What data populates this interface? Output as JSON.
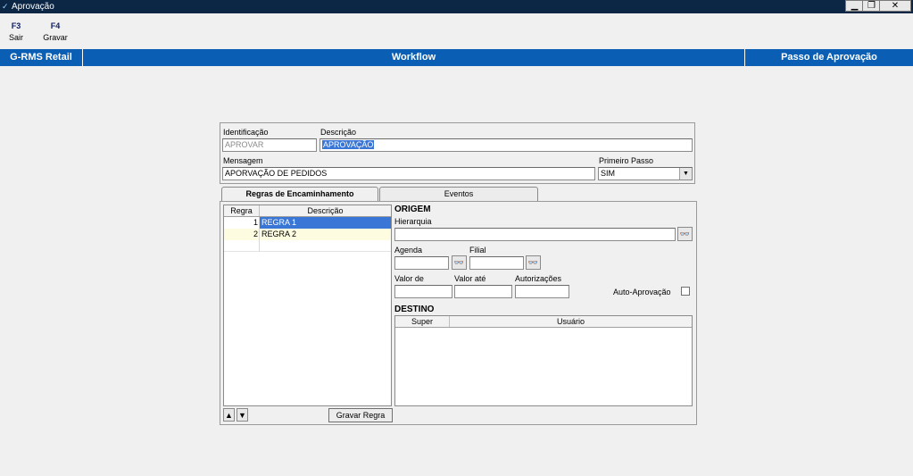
{
  "window": {
    "title": "Aprovação",
    "controls": [
      "▁",
      "❐",
      "✕"
    ]
  },
  "toolbar": {
    "items": [
      {
        "key": "F3",
        "label": "Sair"
      },
      {
        "key": "F4",
        "label": "Gravar"
      }
    ]
  },
  "header": {
    "left": "G-RMS Retail",
    "center": "Workflow",
    "right": "Passo de Aprovação"
  },
  "form": {
    "identificacao_label": "Identificação",
    "identificacao_value": "APROVAR",
    "descricao_label": "Descrição",
    "descricao_value": "APROVAÇÃO",
    "mensagem_label": "Mensagem",
    "mensagem_value": "APORVAÇÃO DE PEDIDOS",
    "primeiro_passo_label": "Primeiro Passo",
    "primeiro_passo_value": "SIM"
  },
  "tabs": [
    {
      "label": "Regras de Encaminhamento"
    },
    {
      "label": "Eventos"
    }
  ],
  "regras": {
    "columns": [
      "Regra",
      "Descrição"
    ],
    "rows": [
      {
        "num": "1",
        "desc": "REGRA 1"
      },
      {
        "num": "2",
        "desc": "REGRA 2"
      }
    ],
    "gravar_label": "Gravar Regra"
  },
  "origem": {
    "title": "ORIGEM",
    "hierarquia_label": "Hierarquia",
    "agenda_label": "Agenda",
    "filial_label": "Filial",
    "valor_de_label": "Valor de",
    "valor_ate_label": "Valor até",
    "autorizacoes_label": "Autorizações",
    "auto_aprovacao_label": "Auto-Aprovação"
  },
  "destino": {
    "title": "DESTINO",
    "columns": [
      "Super",
      "Usuário"
    ]
  },
  "icons": {
    "binoculars": "binoculars-icon",
    "up": "arrow-up-icon",
    "down": "arrow-down-icon"
  }
}
